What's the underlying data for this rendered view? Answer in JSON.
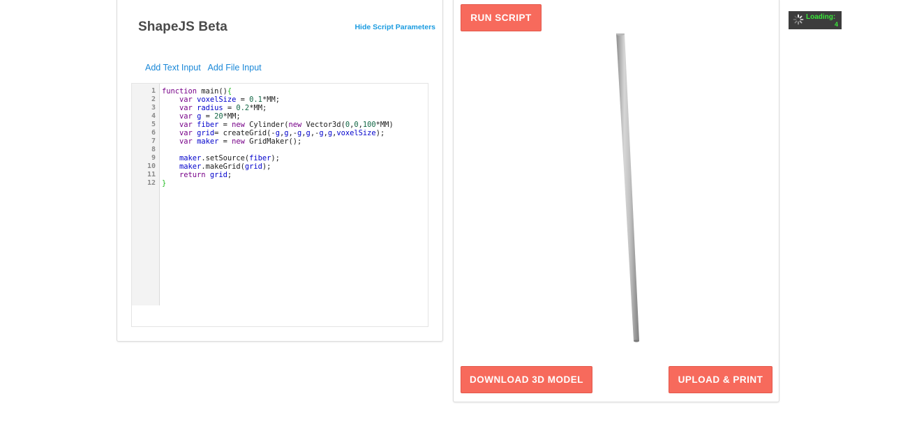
{
  "header": {
    "title": "ShapeJS Beta",
    "hide_params_label": "Hide Script Parameters"
  },
  "inputs": {
    "add_text_label": "Add Text Input",
    "add_file_label": "Add File Input"
  },
  "editor": {
    "line_numbers": [
      "1",
      "2",
      "3",
      "4",
      "5",
      "6",
      "7",
      "8",
      "9",
      "10",
      "11",
      "12"
    ],
    "code_lines": [
      "function main(){",
      "    var voxelSize = 0.1*MM;",
      "    var radius = 0.2*MM;",
      "    var g = 20*MM;",
      "    var fiber = new Cylinder(new Vector3d(0,0,100*MM)",
      "    var grid= createGrid(-g,g,-g,g,-g,g,voxelSize);",
      "    var maker = new GridMaker();",
      "",
      "    maker.setSource(fiber);",
      "    maker.makeGrid(grid);",
      "    return grid;",
      "}"
    ]
  },
  "viewer": {
    "run_label": "RUN SCRIPT",
    "download_label": "DOWNLOAD 3D MODEL",
    "upload_label": "UPLOAD & PRINT"
  },
  "loading": {
    "label": "Loading:",
    "count": "4"
  },
  "colors": {
    "button": "#f76a5c",
    "link": "#1a88d8",
    "loading_text": "#39e639",
    "loading_bg": "#3c3c3c"
  }
}
